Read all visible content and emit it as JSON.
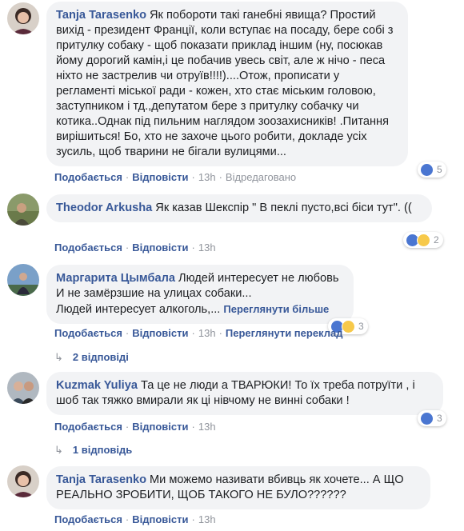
{
  "actions": {
    "like": "Подобається",
    "reply": "Відповісти",
    "translate": "Переглянути переклад"
  },
  "comments": [
    {
      "author": "Tanja Tarasenko",
      "text": "Як побороти такі ганебні явища? Простий вихід - президент Франції, коли вступає на посаду, бере собі з притулку собаку - щоб показати приклад іншим (ну, посюкав йому дорогий камін,і це побачив увесь світ, але ж нічо - песа ніхто не застрелив чи отруїв!!!!)....Отож, прописати у регламенті міської ради - кожен, хто стає міським головою, заступником і тд.,депутатом бере з притулку собачку чи котика..Однак під пильним наглядом зоозахисників! .Питання вирішиться! Бо, хто не захоче цього робити, докладе усіх зусиль, щоб тварини не бігали вулицями...",
      "time": "13h",
      "edited": "Відредаговано",
      "reaction_count": "5"
    },
    {
      "author": "Theodor Arkusha",
      "text": "Як казав Шекспір \" В пеклі пусто,всі біси тут\". ((",
      "time": "13h",
      "reaction_count": "2"
    },
    {
      "author": "Маргарита Цымбала",
      "line1": "Людей интересует не любовь",
      "line2": "И не замёрзшие на улицах собаки...",
      "line3": "Людей интересует алкоголь,...",
      "see_more": "Переглянути більше",
      "time": "13h",
      "reaction_count": "3",
      "replies": "2 відповіді"
    },
    {
      "author": "Kuzmak Yuliya",
      "text": "Та це не люди а ТВАРЮКИ! То їх треба потруїти , і шоб так тяжко вмирали як ці нівчому не винні собаки !",
      "time": "13h",
      "reaction_count": "3",
      "replies": "1 відповідь"
    },
    {
      "author": "Tanja Tarasenko",
      "text": "Ми можемо називати вбивць як хочете... А ЩО РЕАЛЬНО ЗРОБИТИ, ЩОБ ТАКОГО НЕ БУЛО??????",
      "time": "13h"
    }
  ],
  "colors": {
    "link": "#385898",
    "bubble": "#f2f3f5",
    "muted": "#90949c",
    "like": "#4a76d1",
    "sad": "#f7c94a"
  }
}
